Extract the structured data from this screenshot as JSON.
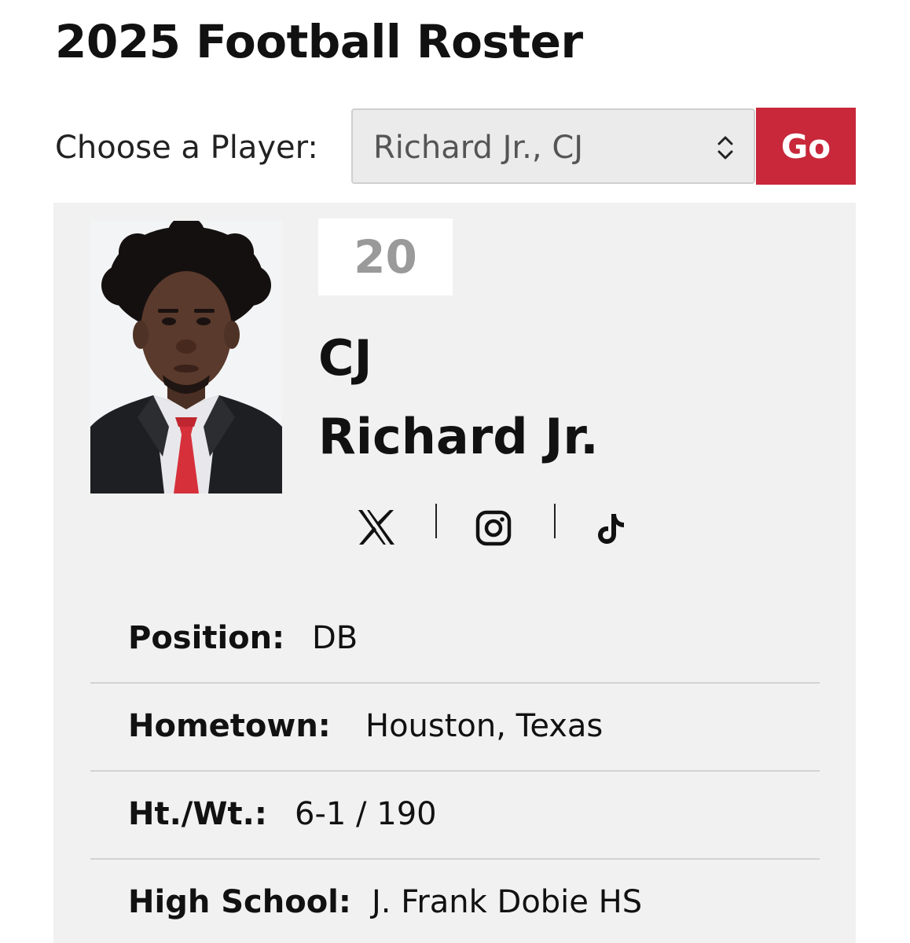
{
  "page": {
    "title": "2025 Football Roster"
  },
  "chooser": {
    "label": "Choose a Player:",
    "selected_player": "Richard Jr., CJ",
    "go_label": "Go"
  },
  "player": {
    "number": "20",
    "first_name": "CJ",
    "last_name": "Richard Jr.",
    "social_icons": [
      "x-icon",
      "instagram-icon",
      "tiktok-icon"
    ],
    "details": [
      {
        "label": "Position:",
        "value": "DB"
      },
      {
        "label": "Hometown:",
        "value": "Houston, Texas"
      },
      {
        "label": "Ht./Wt.:",
        "value": "6-1 / 190"
      },
      {
        "label": "High School:",
        "value": "J. Frank Dobie HS"
      }
    ]
  },
  "colors": {
    "accent": "#c8283a",
    "card_background": "#f1f1f1",
    "jersey_number": "#9a9a9a"
  }
}
